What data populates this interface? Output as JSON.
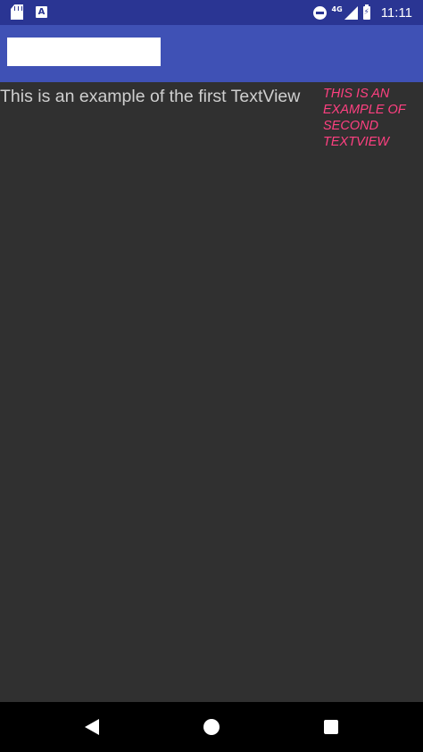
{
  "status_bar": {
    "network": "4G",
    "time": "11:11",
    "icons": [
      "sd-card-icon",
      "text-a-icon",
      "do-not-disturb-icon",
      "signal-icon",
      "battery-charging-icon"
    ]
  },
  "app_bar": {
    "search": {
      "value": "",
      "placeholder": ""
    }
  },
  "content": {
    "first_textview": "This is an example of the first TextView",
    "second_textview": "THIS IS AN EXAMPLE OF SECOND TEXTVIEW"
  },
  "nav_bar": {
    "buttons": [
      "back-icon",
      "home-icon",
      "recents-icon"
    ]
  },
  "colors": {
    "status_bar": "#2a3593",
    "app_bar": "#3f51b5",
    "background": "#303030",
    "first_text": "#cfcfcf",
    "accent_text": "#ff4081",
    "nav_bar": "#000000"
  }
}
